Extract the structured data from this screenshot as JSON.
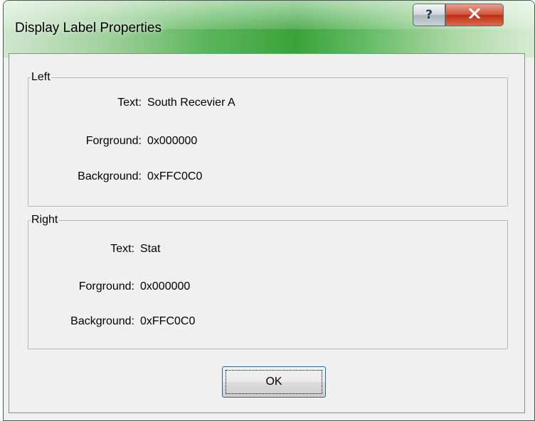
{
  "window": {
    "title": "Display Label Properties",
    "help_label": "?",
    "close_label": "X"
  },
  "left_group": {
    "legend": "Left",
    "text_label": "Text:",
    "text_value": "South Recevier A",
    "foreground_label": "Forground:",
    "foreground_value": "0x000000",
    "background_label": "Background:",
    "background_value": "0xFFC0C0"
  },
  "right_group": {
    "legend": "Right",
    "text_label": "Text:",
    "text_value": "Stat",
    "foreground_label": "Forground:",
    "foreground_value": "0x000000",
    "background_label": "Background:",
    "background_value": "0xFFC0C0"
  },
  "buttons": {
    "ok_label": "OK"
  },
  "icons": [
    "help-icon",
    "close-icon"
  ],
  "colors": {
    "titlebar_accent": "#3aa23a",
    "close_button": "#c8391c",
    "dialog_background": "#f0f0f0"
  }
}
